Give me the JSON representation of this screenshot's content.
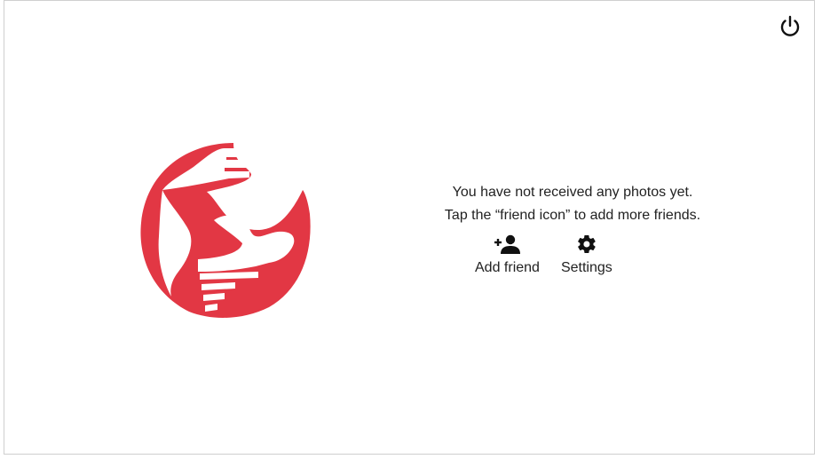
{
  "colors": {
    "brand": "#E23744",
    "text": "#222222",
    "border": "#cfcfcf"
  },
  "header": {
    "power_icon": "power-icon"
  },
  "empty_state": {
    "line1": "You have not received any photos yet.",
    "line2": "Tap the “friend icon” to add more friends."
  },
  "actions": {
    "add_friend": {
      "label": "Add friend",
      "icon": "person-add-icon"
    },
    "settings": {
      "label": "Settings",
      "icon": "gear-icon"
    }
  }
}
